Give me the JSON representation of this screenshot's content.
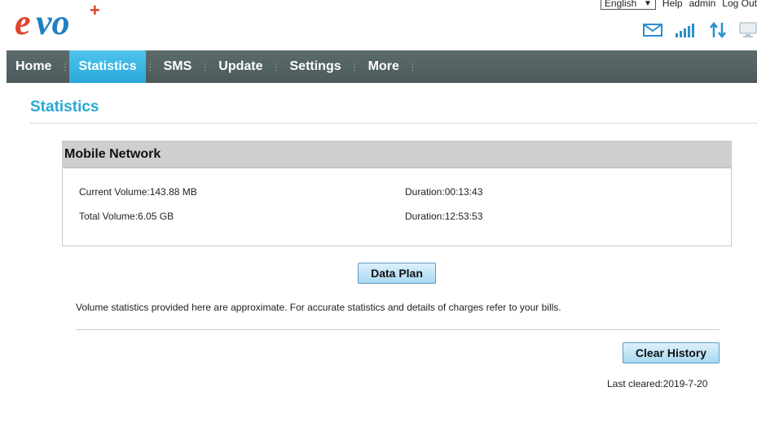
{
  "brand": {
    "logo_text": "evo",
    "logo_plus": "+"
  },
  "header": {
    "language": "English",
    "links": [
      "Help",
      "admin",
      "Log Out"
    ]
  },
  "status_icons": [
    "mail-icon",
    "signal-strength-icon",
    "data-transfer-icon",
    "computer-icon"
  ],
  "nav": {
    "items": [
      {
        "label": "Home",
        "active": false
      },
      {
        "label": "Statistics",
        "active": true
      },
      {
        "label": "SMS",
        "active": false
      },
      {
        "label": "Update",
        "active": false
      },
      {
        "label": "Settings",
        "active": false
      },
      {
        "label": "More",
        "active": false
      }
    ]
  },
  "page": {
    "title": "Statistics"
  },
  "panel": {
    "title": "Mobile Network",
    "current_volume": "Current Volume:143.88 MB",
    "current_duration": "Duration:00:13:43",
    "total_volume": "Total Volume:6.05 GB",
    "total_duration": "Duration:12:53:53"
  },
  "buttons": {
    "data_plan": "Data Plan",
    "clear_history": "Clear History"
  },
  "note": "Volume statistics provided here are approximate. For accurate statistics and details of charges refer to your bills.",
  "last_cleared": "Last cleared:2019-7-20",
  "colors": {
    "accent": "#2aa8d6",
    "brand_red": "#e0432b",
    "brand_blue": "#1f7fc4",
    "nav_bg": "#55646"
  }
}
